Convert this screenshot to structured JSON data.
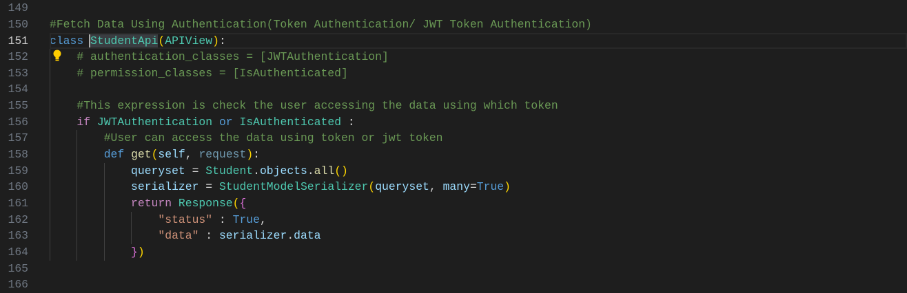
{
  "editor": {
    "current_line": 151,
    "colors": {
      "background": "#1e1e1e",
      "comment": "#6a9955",
      "keyword": "#569cd6",
      "control": "#c586c0",
      "class": "#4ec9b0",
      "variable": "#9cdcfe",
      "function": "#dcdcaa",
      "string": "#ce9178"
    },
    "lines": [
      {
        "num": "149",
        "tokens": []
      },
      {
        "num": "150",
        "tokens": [
          [
            "cm",
            "#Fetch Data Using Authentication(Token Authentication/ JWT Token Authentication)"
          ]
        ]
      },
      {
        "num": "151",
        "tokens": [
          [
            "kw",
            "class"
          ],
          [
            "op",
            " "
          ],
          [
            "cls sel cursor",
            "StudentApi"
          ],
          [
            "b1",
            "("
          ],
          [
            "cls",
            "APIView"
          ],
          [
            "b1",
            ")"
          ],
          [
            "op",
            ":"
          ]
        ]
      },
      {
        "num": "152",
        "tokens": [
          [
            "op",
            "    "
          ],
          [
            "cm",
            "# authentication_classes = [JWTAuthentication]"
          ]
        ]
      },
      {
        "num": "153",
        "tokens": [
          [
            "op",
            "    "
          ],
          [
            "cm",
            "# permission_classes = [IsAuthenticated]"
          ]
        ]
      },
      {
        "num": "154",
        "tokens": []
      },
      {
        "num": "155",
        "tokens": [
          [
            "op",
            "    "
          ],
          [
            "cm",
            "#This expression is check the user accessing the data using which token"
          ]
        ]
      },
      {
        "num": "156",
        "tokens": [
          [
            "op",
            "    "
          ],
          [
            "ctl",
            "if"
          ],
          [
            "op",
            " "
          ],
          [
            "cls",
            "JWTAuthentication"
          ],
          [
            "op",
            " "
          ],
          [
            "kw",
            "or"
          ],
          [
            "op",
            " "
          ],
          [
            "cls",
            "IsAuthenticated"
          ],
          [
            "op",
            " :"
          ]
        ]
      },
      {
        "num": "157",
        "tokens": [
          [
            "op",
            "        "
          ],
          [
            "cm",
            "#User can access the data using token or jwt token"
          ]
        ]
      },
      {
        "num": "158",
        "tokens": [
          [
            "op",
            "        "
          ],
          [
            "kw",
            "def"
          ],
          [
            "op",
            " "
          ],
          [
            "fn",
            "get"
          ],
          [
            "b1",
            "("
          ],
          [
            "var",
            "self"
          ],
          [
            "op",
            ", "
          ],
          [
            "unused",
            "request"
          ],
          [
            "b1",
            ")"
          ],
          [
            "op",
            ":"
          ]
        ]
      },
      {
        "num": "159",
        "tokens": [
          [
            "op",
            "            "
          ],
          [
            "var",
            "queryset"
          ],
          [
            "op",
            " = "
          ],
          [
            "cls",
            "Student"
          ],
          [
            "op",
            "."
          ],
          [
            "var",
            "objects"
          ],
          [
            "op",
            "."
          ],
          [
            "fn",
            "all"
          ],
          [
            "b1",
            "()"
          ]
        ]
      },
      {
        "num": "160",
        "tokens": [
          [
            "op",
            "            "
          ],
          [
            "var",
            "serializer"
          ],
          [
            "op",
            " = "
          ],
          [
            "cls",
            "StudentModelSerializer"
          ],
          [
            "b1",
            "("
          ],
          [
            "var",
            "queryset"
          ],
          [
            "op",
            ", "
          ],
          [
            "var",
            "many"
          ],
          [
            "op",
            "="
          ],
          [
            "kw",
            "True"
          ],
          [
            "b1",
            ")"
          ]
        ]
      },
      {
        "num": "161",
        "tokens": [
          [
            "op",
            "            "
          ],
          [
            "ctl",
            "return"
          ],
          [
            "op",
            " "
          ],
          [
            "cls",
            "Response"
          ],
          [
            "b1",
            "("
          ],
          [
            "b2",
            "{"
          ]
        ]
      },
      {
        "num": "162",
        "tokens": [
          [
            "op",
            "                "
          ],
          [
            "str",
            "\"status\""
          ],
          [
            "op",
            " : "
          ],
          [
            "kw",
            "True"
          ],
          [
            "op",
            ","
          ]
        ]
      },
      {
        "num": "163",
        "tokens": [
          [
            "op",
            "                "
          ],
          [
            "str",
            "\"data\""
          ],
          [
            "op",
            " : "
          ],
          [
            "var",
            "serializer"
          ],
          [
            "op",
            "."
          ],
          [
            "var",
            "data"
          ]
        ]
      },
      {
        "num": "164",
        "tokens": [
          [
            "op",
            "            "
          ],
          [
            "b2",
            "}"
          ],
          [
            "b1",
            ")"
          ]
        ]
      },
      {
        "num": "165",
        "tokens": []
      },
      {
        "num": "166",
        "tokens": []
      }
    ]
  }
}
